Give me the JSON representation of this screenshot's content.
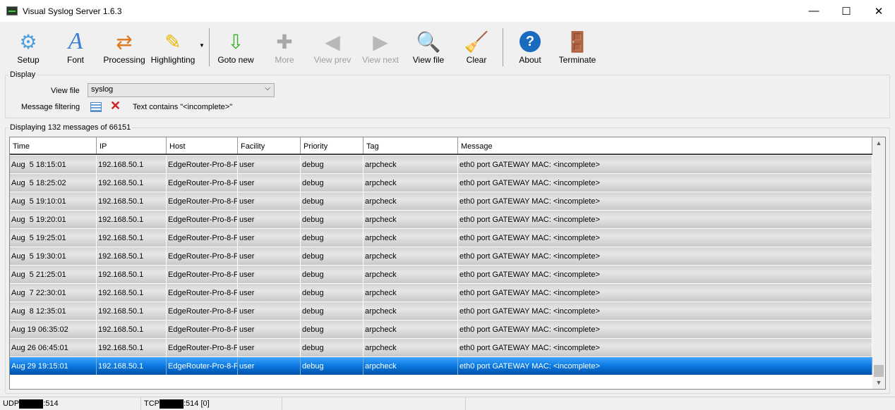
{
  "window": {
    "title": "Visual Syslog Server 1.6.3",
    "minimize": "—",
    "maximize": "☐",
    "close": "✕"
  },
  "toolbar": [
    {
      "label": "Setup",
      "icon": "gear-icon",
      "glyph": "⚙",
      "color": "#4a9ee0",
      "enabled": true
    },
    {
      "label": "Font",
      "icon": "font-icon",
      "glyph": "A",
      "color": "#3a7fd0",
      "enabled": true
    },
    {
      "label": "Processing",
      "icon": "processing-icon",
      "glyph": "⇄",
      "color": "#e07a20",
      "enabled": true
    },
    {
      "label": "Highlighting",
      "icon": "highlighter-icon",
      "glyph": "✎",
      "color": "#e8b800",
      "enabled": true
    },
    {
      "label": "Goto new",
      "icon": "goto-new-icon",
      "glyph": "⇩",
      "color": "#3cb030",
      "enabled": true
    },
    {
      "label": "More",
      "icon": "plus-icon",
      "glyph": "✚",
      "color": "#a8a8a8",
      "enabled": false
    },
    {
      "label": "View prev",
      "icon": "arrow-left-icon",
      "glyph": "◀",
      "color": "#b8b8b8",
      "enabled": false
    },
    {
      "label": "View next",
      "icon": "arrow-right-icon",
      "glyph": "▶",
      "color": "#b8b8b8",
      "enabled": false
    },
    {
      "label": "View file",
      "icon": "magnifier-icon",
      "glyph": "🔍",
      "color": "#3a8ad0",
      "enabled": true
    },
    {
      "label": "Clear",
      "icon": "broom-icon",
      "glyph": "🧹",
      "color": "#c89020",
      "enabled": true
    },
    {
      "label": "About",
      "icon": "help-icon",
      "glyph": "?",
      "color": "#1a6ac0",
      "enabled": true
    },
    {
      "label": "Terminate",
      "icon": "exit-door-icon",
      "glyph": "🚪",
      "color": "#8a5020",
      "enabled": true
    }
  ],
  "display": {
    "legend": "Display",
    "view_file_label": "View file",
    "view_file_value": "syslog",
    "filter_label": "Message filtering",
    "filter_text": "Text contains \"<incomplete>\""
  },
  "messages": {
    "legend": "Displaying 132 messages of 66151",
    "columns": [
      "Time",
      "IP",
      "Host",
      "Facility",
      "Priority",
      "Tag",
      "Message"
    ],
    "rows": [
      [
        "Aug  5 18:15:01",
        "192.168.50.1",
        "EdgeRouter-Pro-8-P",
        "user",
        "debug",
        "arpcheck",
        "eth0 port GATEWAY MAC: <incomplete>"
      ],
      [
        "Aug  5 18:25:02",
        "192.168.50.1",
        "EdgeRouter-Pro-8-P",
        "user",
        "debug",
        "arpcheck",
        "eth0 port GATEWAY MAC: <incomplete>"
      ],
      [
        "Aug  5 19:10:01",
        "192.168.50.1",
        "EdgeRouter-Pro-8-P",
        "user",
        "debug",
        "arpcheck",
        "eth0 port GATEWAY MAC: <incomplete>"
      ],
      [
        "Aug  5 19:20:01",
        "192.168.50.1",
        "EdgeRouter-Pro-8-P",
        "user",
        "debug",
        "arpcheck",
        "eth0 port GATEWAY MAC: <incomplete>"
      ],
      [
        "Aug  5 19:25:01",
        "192.168.50.1",
        "EdgeRouter-Pro-8-P",
        "user",
        "debug",
        "arpcheck",
        "eth0 port GATEWAY MAC: <incomplete>"
      ],
      [
        "Aug  5 19:30:01",
        "192.168.50.1",
        "EdgeRouter-Pro-8-P",
        "user",
        "debug",
        "arpcheck",
        "eth0 port GATEWAY MAC: <incomplete>"
      ],
      [
        "Aug  5 21:25:01",
        "192.168.50.1",
        "EdgeRouter-Pro-8-P",
        "user",
        "debug",
        "arpcheck",
        "eth0 port GATEWAY MAC: <incomplete>"
      ],
      [
        "Aug  7 22:30:01",
        "192.168.50.1",
        "EdgeRouter-Pro-8-P",
        "user",
        "debug",
        "arpcheck",
        "eth0 port GATEWAY MAC: <incomplete>"
      ],
      [
        "Aug  8 12:35:01",
        "192.168.50.1",
        "EdgeRouter-Pro-8-P",
        "user",
        "debug",
        "arpcheck",
        "eth0 port GATEWAY MAC: <incomplete>"
      ],
      [
        "Aug 19 06:35:02",
        "192.168.50.1",
        "EdgeRouter-Pro-8-P",
        "user",
        "debug",
        "arpcheck",
        "eth0 port GATEWAY MAC: <incomplete>"
      ],
      [
        "Aug 26 06:45:01",
        "192.168.50.1",
        "EdgeRouter-Pro-8-P",
        "user",
        "debug",
        "arpcheck",
        "eth0 port GATEWAY MAC: <incomplete>"
      ],
      [
        "Aug 29 19:15:01",
        "192.168.50.1",
        "EdgeRouter-Pro-8-P",
        "user",
        "debug",
        "arpcheck",
        "eth0 port GATEWAY MAC: <incomplete>"
      ]
    ],
    "selected_row": 11
  },
  "status": {
    "udp_label": "UDP",
    "udp_port": ":514",
    "tcp_label": "TCP",
    "tcp_port": ":514 [0]"
  }
}
